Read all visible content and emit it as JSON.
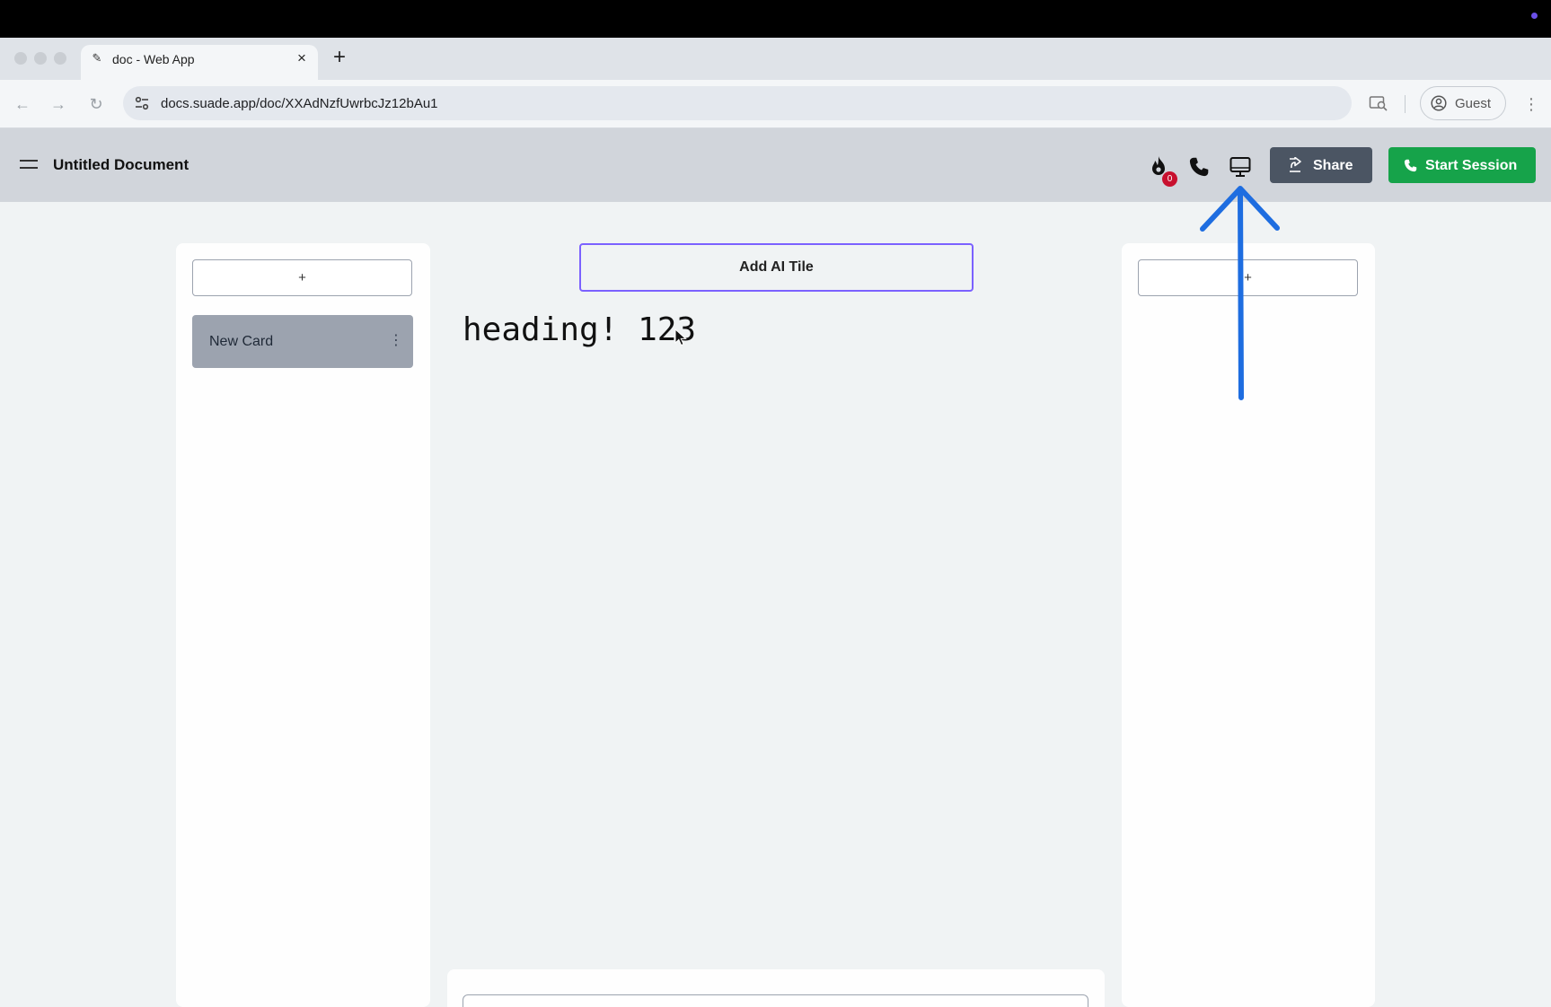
{
  "browser": {
    "tab_title": "doc - Web App",
    "tab_favicon": "pen-icon",
    "tab_close": "×",
    "new_tab": "+",
    "url": "docs.suade.app/doc/XXAdNzfUwrbcJz12bAu1",
    "profile_label": "Guest",
    "nav": {
      "back": "←",
      "forward": "→",
      "reload": "↻"
    },
    "menu_glyph": "⋮"
  },
  "header": {
    "title": "Untitled Document",
    "streak_badge": "0",
    "share_label": "Share",
    "start_session_label": "Start Session",
    "icons": [
      "menu-icon",
      "fire-icon",
      "phone-icon",
      "monitor-icon",
      "share-icon",
      "phone-icon"
    ]
  },
  "left_column": {
    "add_label": "+",
    "cards": [
      {
        "label": "New Card",
        "menu_glyph": "⋮"
      }
    ]
  },
  "right_column": {
    "add_label": "+"
  },
  "center": {
    "add_ai_tile_label": "Add AI Tile",
    "heading": "heading! 123"
  },
  "colors": {
    "accent_purple": "#7b61ff",
    "share_bg": "#4b5563",
    "start_session_bg": "#16a34a",
    "badge_red": "#c8102e",
    "annotation_arrow": "#1e6de0"
  }
}
